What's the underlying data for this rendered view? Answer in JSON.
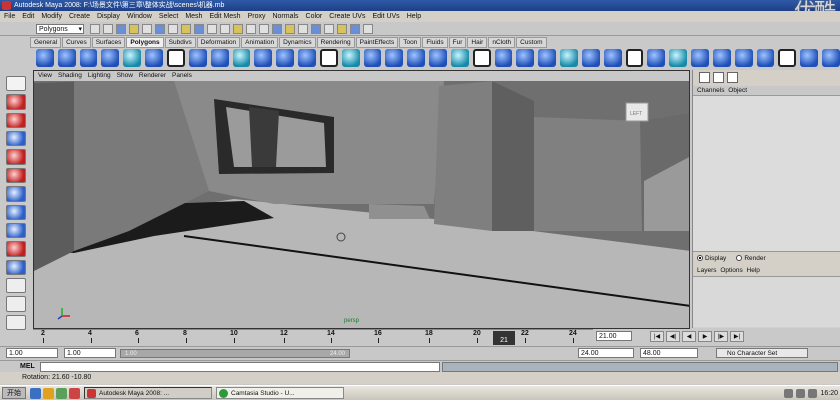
{
  "window": {
    "title": "Autodesk Maya 2008: F:\\场景文件\\第三章\\整体实战\\scenes\\机器.mb",
    "watermark": "优酷"
  },
  "menu": [
    "File",
    "Edit",
    "Modify",
    "Create",
    "Display",
    "Window",
    "Select",
    "Mesh",
    "Edit Mesh",
    "Proxy",
    "Normals",
    "Color",
    "Create UVs",
    "Edit UVs",
    "Help"
  ],
  "status_line": {
    "mode": "Polygons"
  },
  "shelf_tabs": [
    {
      "label": "General",
      "active": false
    },
    {
      "label": "Curves",
      "active": false
    },
    {
      "label": "Surfaces",
      "active": false
    },
    {
      "label": "Polygons",
      "active": true
    },
    {
      "label": "Subdivs",
      "active": false
    },
    {
      "label": "Deformation",
      "active": false
    },
    {
      "label": "Animation",
      "active": false
    },
    {
      "label": "Dynamics",
      "active": false
    },
    {
      "label": "Rendering",
      "active": false
    },
    {
      "label": "PaintEffects",
      "active": false
    },
    {
      "label": "Toon",
      "active": false
    },
    {
      "label": "Fluids",
      "active": false
    },
    {
      "label": "Fur",
      "active": false
    },
    {
      "label": "Hair",
      "active": false
    },
    {
      "label": "nCloth",
      "active": false
    },
    {
      "label": "Custom",
      "active": false
    }
  ],
  "viewport": {
    "menu": [
      "View",
      "Shading",
      "Lighting",
      "Show",
      "Renderer",
      "Panels"
    ],
    "camera": "persp",
    "view_cube_label": "LEFT"
  },
  "channel_box": {
    "header": [
      "Channels",
      "Object"
    ]
  },
  "layer_editor": {
    "display_label": "Display",
    "render_label": "Render",
    "menu": [
      "Layers",
      "Options",
      "Help"
    ]
  },
  "time_slider": {
    "ticks": [
      "2",
      "4",
      "6",
      "8",
      "10",
      "12",
      "14",
      "16",
      "18",
      "20",
      "22",
      "24"
    ],
    "current": "21",
    "current_field": "21.00"
  },
  "range_slider": {
    "start_time": "1.00",
    "playback_start": "1.00",
    "bar_start": "1.00",
    "bar_end": "24.00",
    "playback_end": "24.00",
    "end_time": "48.00",
    "character_set": "No Character Set"
  },
  "command_line": {
    "label": "MEL"
  },
  "help_line": "Rotation: 21.60 -10.80",
  "taskbar": {
    "start": "开始",
    "tasks": [
      {
        "label": "Autodesk Maya 2008: ...",
        "active": true
      },
      {
        "label": "Camtasia Studio - U...",
        "active": false
      }
    ],
    "clock": "16:20"
  }
}
